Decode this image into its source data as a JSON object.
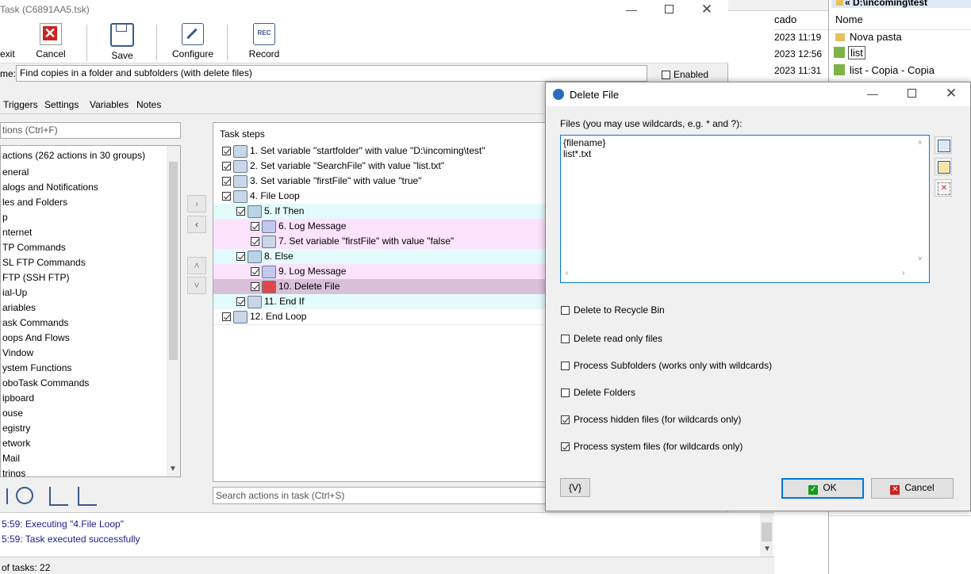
{
  "main": {
    "title": "Task (C6891AA5.tsk)",
    "toolbar": {
      "exit": "exit",
      "cancel": "Cancel",
      "save": "Save",
      "configure": "Configure",
      "record": "Record",
      "rec_badge": "REC"
    },
    "name_label": "me:",
    "name_value": "Find copies in a folder and subfolders (with delete files)",
    "enabled_label": "Enabled",
    "tabs": [
      "Triggers",
      "Settings",
      "Variables",
      "Notes"
    ],
    "search_placeholder": "tions (Ctrl+F)",
    "actions_header": "actions (262 actions in 30 groups)",
    "action_groups": [
      "eneral",
      "alogs and Notifications",
      "les and Folders",
      "p",
      "nternet",
      "TP Commands",
      "SL FTP Commands",
      "FTP (SSH FTP)",
      "ial-Up",
      "ariables",
      "ask Commands",
      "oops And Flows",
      "Vindow",
      "ystem Functions",
      "oboTask Commands",
      "ipboard",
      "ouse",
      "egistry",
      "etwork",
      "Mail",
      "trings"
    ],
    "steps_header": "Task steps",
    "steps": [
      {
        "label": "1. Set variable \"startfolder\" with value \"D:\\incoming\\test\"",
        "indent": 0,
        "bg": "#ffffff",
        "icon": "variable-icon"
      },
      {
        "label": "2. Set variable \"SearchFile\" with value \"list.txt\"",
        "indent": 0,
        "bg": "#ffffff",
        "icon": "variable-icon"
      },
      {
        "label": "3. Set variable \"firstFile\" with value \"true\"",
        "indent": 0,
        "bg": "#ffffff",
        "icon": "variable-icon"
      },
      {
        "label": "4. File Loop",
        "indent": 0,
        "bg": "#ffffff",
        "icon": "loop-icon"
      },
      {
        "label": "5. If Then",
        "indent": 1,
        "bg": "#e3fbfb",
        "icon": "branch-icon"
      },
      {
        "label": "6. Log Message",
        "indent": 2,
        "bg": "#fbe3fb",
        "icon": "log-icon"
      },
      {
        "label": "7. Set variable \"firstFile\" with value \"false\"",
        "indent": 2,
        "bg": "#fbe3fb",
        "icon": "variable-icon"
      },
      {
        "label": "8. Else",
        "indent": 1,
        "bg": "#e3fbfb",
        "icon": "branch-icon"
      },
      {
        "label": "9. Log Message",
        "indent": 2,
        "bg": "#fbe3fb",
        "icon": "log-icon"
      },
      {
        "label": "10. Delete File",
        "indent": 2,
        "bg": "#d8c0d8",
        "icon": "delete-icon"
      },
      {
        "label": "11. End If",
        "indent": 1,
        "bg": "#e3fbfb",
        "icon": "end-icon"
      },
      {
        "label": "12. End Loop",
        "indent": 0,
        "bg": "#ffffff",
        "icon": "end-icon"
      }
    ],
    "search_task_placeholder": "Search actions in task (Ctrl+S)",
    "log_lines": [
      "5:59: Executing \"4.File Loop\"",
      "5:59: Task executed successfully"
    ],
    "status": "of tasks: 22"
  },
  "bg_window": {
    "col_header": "cado",
    "rows": [
      "2023 11:19",
      "2023 12:56",
      "2023 11:31"
    ]
  },
  "explorer": {
    "path": "« D:\\incoming\\test",
    "col_name": "Nome",
    "items": [
      "Nova pasta",
      "list",
      "list - Copia - Copia"
    ]
  },
  "dialog": {
    "title": "Delete File",
    "files_label": "Files (you may use wildcards, e.g. * and ?):",
    "files_value": "{filename}\nlist*.txt",
    "options": [
      {
        "label": "Delete to Recycle Bin",
        "checked": false
      },
      {
        "label": "Delete read only files",
        "checked": false
      },
      {
        "label": "Process Subfolders (works only with wildcards)",
        "checked": false
      },
      {
        "label": "Delete Folders",
        "checked": false
      },
      {
        "label": "Process hidden files (for wildcards only)",
        "checked": true
      },
      {
        "label": "Process system files (for wildcards only)",
        "checked": true
      }
    ],
    "var_button": "{V}",
    "ok": "OK",
    "cancel": "Cancel"
  },
  "colors": {
    "accent": "#0078d7",
    "cyan_row": "#e3fbfb",
    "pink_row": "#fbe3fb",
    "selected_row": "#d8c0d8",
    "log_text": "#1a1a8c"
  }
}
